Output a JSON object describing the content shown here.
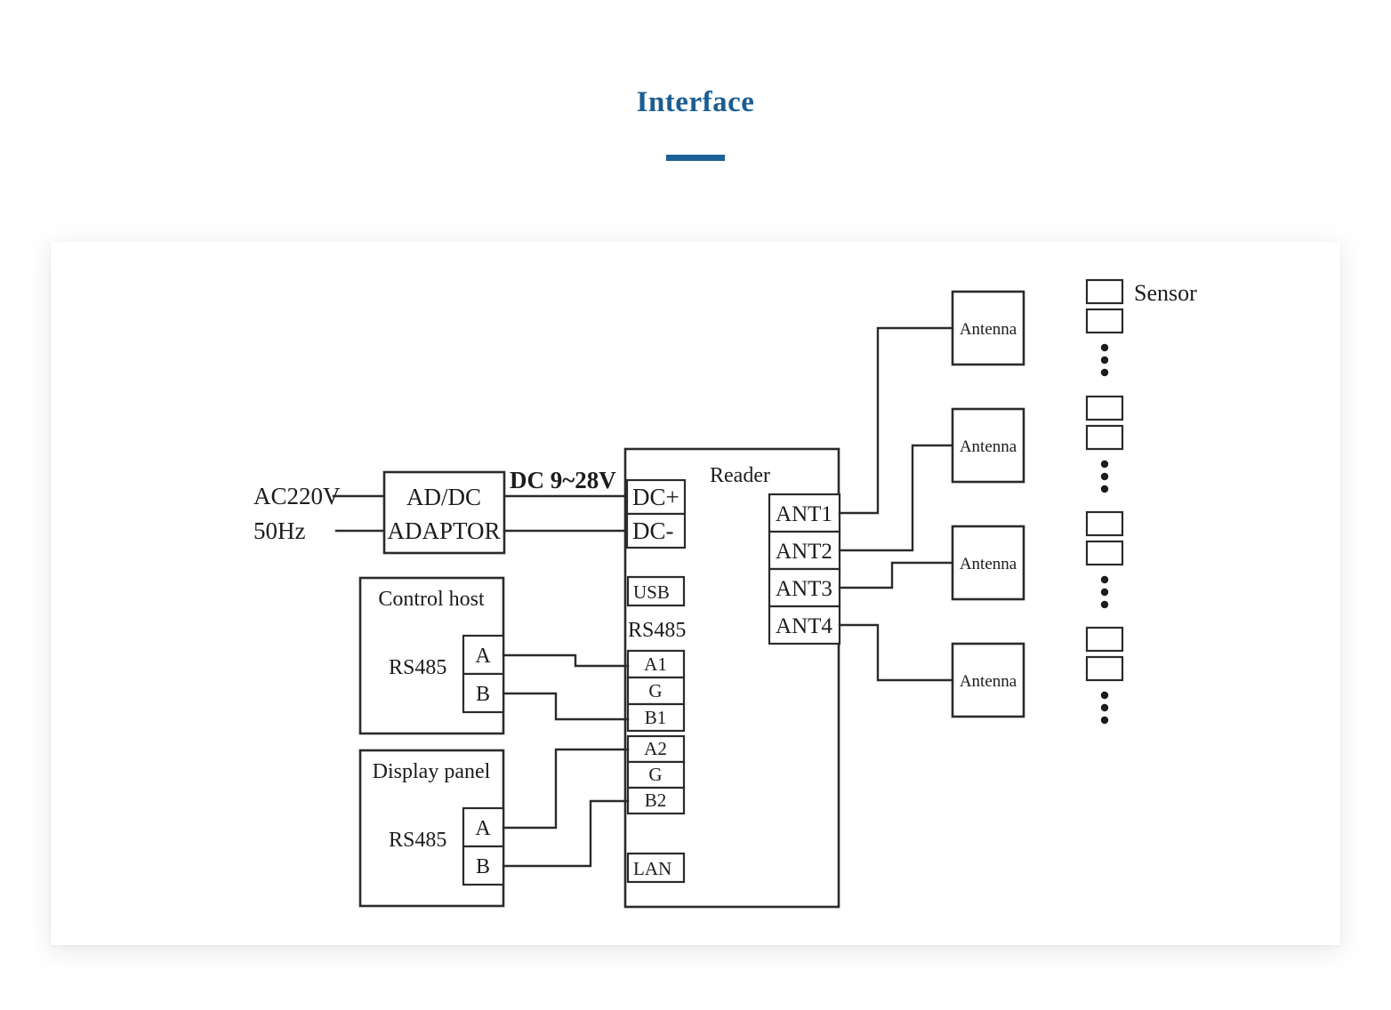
{
  "header": {
    "title": "Interface"
  },
  "diagram": {
    "type": "block-wiring-diagram",
    "power": {
      "source_line1": "AC220V",
      "source_line2": "50Hz",
      "adapter_line1": "AD/DC",
      "adapter_line2": "ADAPTOR",
      "output_label": "DC 9~28V"
    },
    "reader": {
      "title": "Reader",
      "power_terminals": [
        "DC+",
        "DC-"
      ],
      "usb_terminal": "USB",
      "rs485_label": "RS485",
      "rs485_terminals_group1": [
        "A1",
        "G",
        "B1"
      ],
      "rs485_terminals_group2": [
        "A2",
        "G",
        "B2"
      ],
      "lan_terminal": "LAN",
      "antenna_ports": [
        "ANT1",
        "ANT2",
        "ANT3",
        "ANT4"
      ]
    },
    "hosts": [
      {
        "title": "Control host",
        "bus_label": "RS485",
        "terminals": [
          "A",
          "B"
        ]
      },
      {
        "title": "Display panel",
        "bus_label": "RS485",
        "terminals": [
          "A",
          "B"
        ]
      }
    ],
    "antennas": [
      "Antenna",
      "Antenna",
      "Antenna",
      "Antenna"
    ],
    "sensor_label": "Sensor",
    "sensor_groups": 4,
    "sensors_per_group": 2,
    "ellipsis_dots_per_group": 3,
    "colors": {
      "title": "#1a5e93",
      "rule": "#1a6196",
      "line": "#2b2b2b",
      "panel": "#ffffff"
    }
  }
}
